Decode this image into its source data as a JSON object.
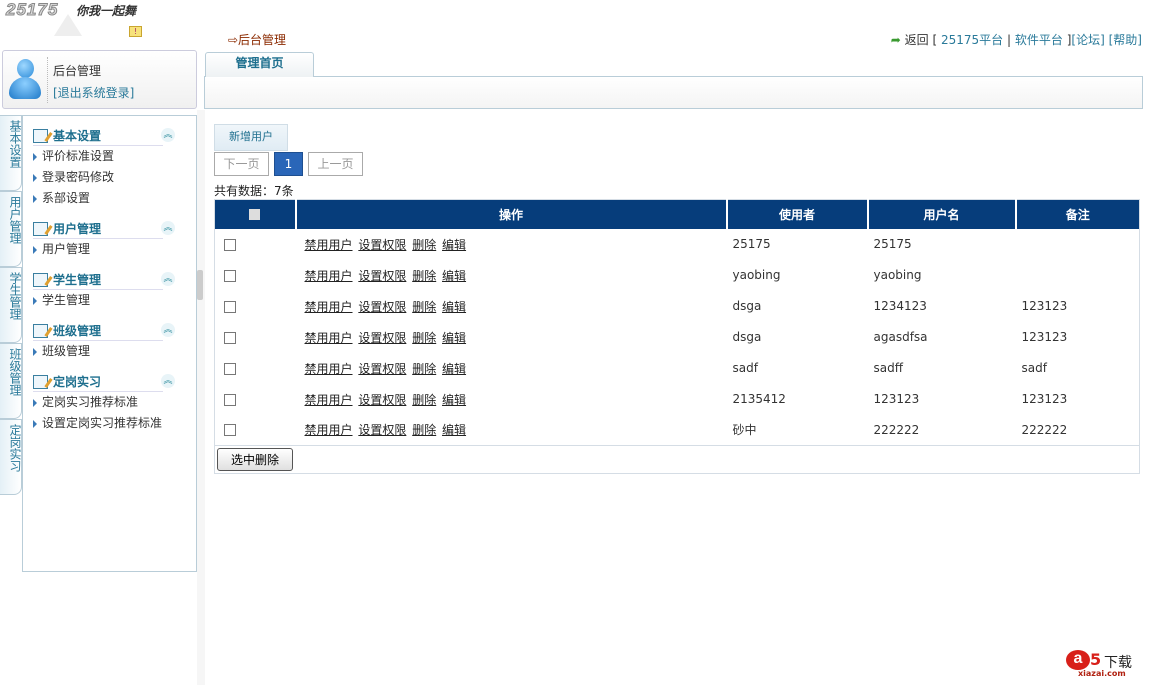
{
  "logo": {
    "text": "25175",
    "slogan": "你我一起舞"
  },
  "breadcrumb": "⇨后台管理",
  "top_links": {
    "back_label": "返回",
    "platform_25175": "25175平台",
    "software_platform": "软件平台",
    "forum": "[论坛]",
    "help": "[帮助]",
    "open": "[",
    "sep": "|",
    "close": "]"
  },
  "user": {
    "name": "后台管理",
    "logout": "[退出系统登录]"
  },
  "vertical_tabs": [
    "基本设置",
    "用户管理",
    "学生管理",
    "班级管理",
    "定岗实习"
  ],
  "menu": [
    {
      "title": "基本设置",
      "items": [
        "评价标准设置",
        "登录密码修改",
        "系部设置"
      ]
    },
    {
      "title": "用户管理",
      "items": [
        "用户管理"
      ]
    },
    {
      "title": "学生管理",
      "items": [
        "学生管理"
      ]
    },
    {
      "title": "班级管理",
      "items": [
        "班级管理"
      ]
    },
    {
      "title": "定岗实习",
      "items": [
        "定岗实习推荐标准",
        "设置定岗实习推荐标准"
      ]
    }
  ],
  "main_tab": "管理首页",
  "new_user": "新增用户",
  "pagination": {
    "next": "下一页",
    "current": "1",
    "prev": "上一页"
  },
  "count_text": "共有数据：7条",
  "table": {
    "headers": [
      "操作",
      "使用者",
      "用户名",
      "备注"
    ],
    "actions": [
      "禁用用户",
      "设置权限",
      "删除",
      "编辑"
    ],
    "rows": [
      [
        "25175",
        "25175",
        ""
      ],
      [
        "yaobing",
        "yaobing",
        ""
      ],
      [
        "dsga",
        "1234123",
        "123123"
      ],
      [
        "dsga",
        "agasdfsa",
        "123123"
      ],
      [
        "sadf",
        "sadff",
        "sadf"
      ],
      [
        "2135412",
        "123123",
        "123123"
      ],
      [
        "砂中",
        "222222",
        "222222"
      ]
    ]
  },
  "delete_selected": "选中删除",
  "watermark": {
    "brand": "a5",
    "text": "下载",
    "url": "xiazai.com"
  },
  "colors": {
    "header": "#063d7b",
    "accent": "#1e6f8e",
    "link": "#2a7a9a"
  }
}
